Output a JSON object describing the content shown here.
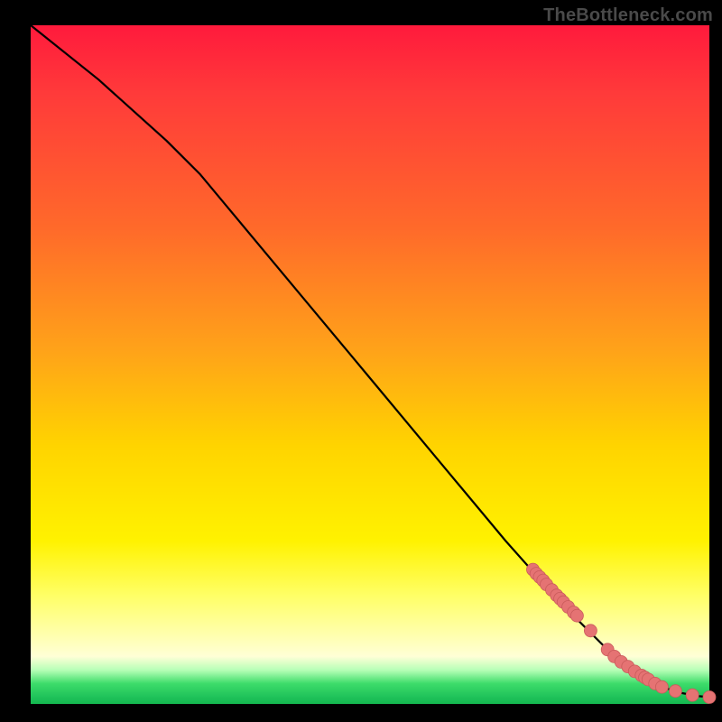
{
  "attribution": "TheBottleneck.com",
  "colors": {
    "curve": "#000000",
    "point_fill": "#e57373",
    "point_stroke": "#c95b5b"
  },
  "chart_data": {
    "type": "line",
    "title": "",
    "xlabel": "",
    "ylabel": "",
    "xlim": [
      0,
      100
    ],
    "ylim": [
      0,
      100
    ],
    "grid": false,
    "series": [
      {
        "name": "curve",
        "x": [
          0,
          10,
          20,
          25,
          30,
          40,
          50,
          60,
          70,
          78,
          82,
          86,
          88,
          90,
          92,
          94,
          96,
          98,
          100
        ],
        "y": [
          100,
          92,
          83,
          78,
          72,
          60,
          48,
          36,
          24,
          15,
          11,
          7,
          5.5,
          4,
          3,
          2.2,
          1.6,
          1.2,
          1
        ]
      }
    ],
    "points": {
      "name": "markers",
      "x": [
        74.0,
        74.5,
        75.0,
        75.5,
        76.0,
        76.8,
        77.5,
        78.0,
        78.5,
        79.2,
        80.0,
        80.5,
        82.5,
        85.0,
        86.0,
        87.0,
        88.0,
        89.0,
        90.0,
        90.5,
        91.0,
        92.0,
        93.0,
        95.0,
        97.5,
        100.0
      ],
      "y": [
        19.8,
        19.2,
        18.7,
        18.2,
        17.6,
        16.8,
        16.0,
        15.5,
        15.0,
        14.3,
        13.5,
        13.0,
        10.8,
        8.0,
        7.0,
        6.2,
        5.5,
        4.8,
        4.2,
        3.9,
        3.6,
        3.0,
        2.5,
        1.9,
        1.3,
        1.0
      ]
    }
  }
}
